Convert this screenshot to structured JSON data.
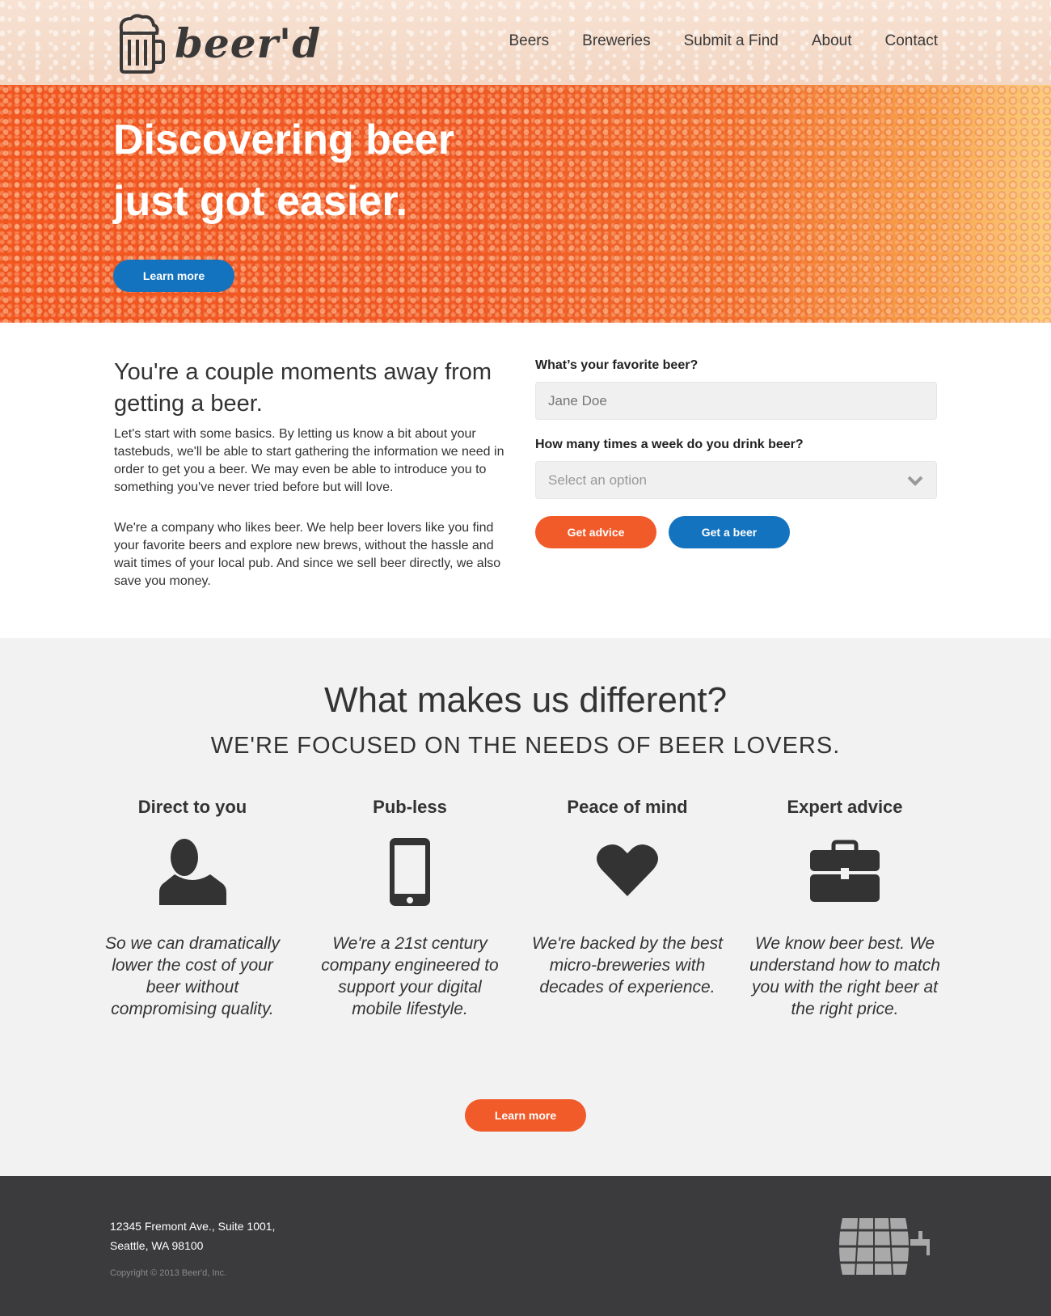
{
  "brand": {
    "logo_text": "beer'd"
  },
  "nav": {
    "items": [
      "Beers",
      "Breweries",
      "Submit a Find",
      "About",
      "Contact"
    ]
  },
  "hero": {
    "title_line1": "Discovering beer",
    "title_line2": "just got easier.",
    "cta_label": "Learn more"
  },
  "intro": {
    "heading": "You're a couple moments away from getting a beer.",
    "para1": "Let's start with some basics. By letting us know a bit about your tastebuds, we'll be able to start gathering the information we need in order to get you a beer. We may even be able to introduce you to something you've never tried before but will love.",
    "para2": "We're a company who likes beer. We help beer lovers like you find your favorite beers and explore new brews, without the hassle and wait times of your local pub. And since we sell beer directly, we also save you money."
  },
  "form": {
    "q1_label": "What’s your favorite beer?",
    "q1_placeholder": "Jane Doe",
    "q2_label": "How many times a week do you drink beer?",
    "q2_placeholder": "Select an option",
    "advice_label": "Get advice",
    "beer_label": "Get a beer"
  },
  "features": {
    "title": "What makes us different?",
    "subtitle": "WE'RE FOCUSED ON THE NEEDS OF BEER LOVERS.",
    "items": [
      {
        "title": "Direct to you",
        "icon": "person-icon",
        "text": "So we can dramatically lower the cost of your beer without compromising quality."
      },
      {
        "title": "Pub-less",
        "icon": "phone-icon",
        "text": "We're a 21st century company engineered to support your digital mobile lifestyle."
      },
      {
        "title": "Peace of mind",
        "icon": "heart-icon",
        "text": "We're backed by the best micro-breweries with decades of experience."
      },
      {
        "title": "Expert advice",
        "icon": "briefcase-icon",
        "text": "We know beer best. We understand how to match you with the right beer at the right price."
      }
    ],
    "cta_label": "Learn more"
  },
  "footer": {
    "address_line1": "12345 Fremont Ave., Suite 1001,",
    "address_line2": "Seattle, WA 98100",
    "copyright": "Copyright © 2013 Beer'd, Inc."
  },
  "colors": {
    "accent_orange": "#f15a29",
    "accent_blue": "#1473bf",
    "footer_bg": "#3b3b3d"
  }
}
